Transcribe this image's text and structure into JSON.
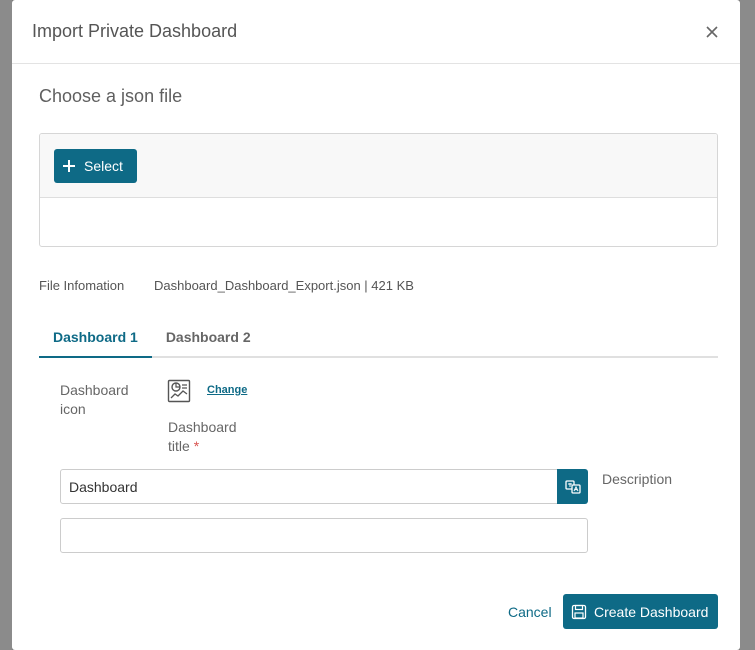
{
  "modal": {
    "title": "Import Private Dashboard",
    "close_icon": "close-icon"
  },
  "file_section": {
    "heading": "Choose a json file",
    "select_label": "Select",
    "select_icon": "plus-icon"
  },
  "file_info": {
    "label": "File Infomation",
    "value": "Dashboard_Dashboard_Export.json | 421 KB"
  },
  "tabs": [
    {
      "label": "Dashboard 1",
      "active": true
    },
    {
      "label": "Dashboard 2",
      "active": false
    }
  ],
  "form": {
    "icon_label": "Dashboard icon",
    "icon_name": "dashboard-chart-icon",
    "change_label": "Change",
    "title_label": "Dashboard title",
    "required_mark": "*",
    "title_value": "Dashboard",
    "translate_icon": "translate-icon",
    "description_label": "Description",
    "description_value": ""
  },
  "footer": {
    "cancel_label": "Cancel",
    "create_label": "Create Dashboard",
    "create_icon": "save-icon"
  },
  "colors": {
    "primary": "#0e6a86",
    "required": "#d9534f"
  }
}
